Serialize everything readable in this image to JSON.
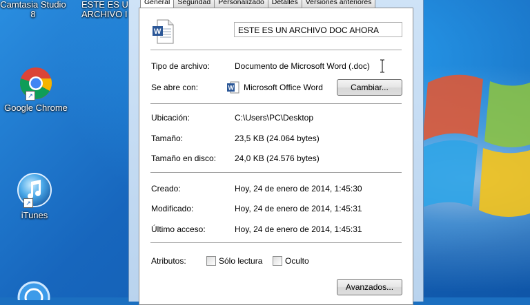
{
  "desktop": {
    "icons": [
      {
        "label": "Camtasia Studio 8",
        "name": "camtasia"
      },
      {
        "label": "ESTE ES UN ARCHIVO D...",
        "name": "doc"
      },
      {
        "label": "Google Chrome",
        "name": "chrome"
      },
      {
        "label": "iTunes",
        "name": "itunes"
      }
    ],
    "camtasia_line1": "Camtasia Studio",
    "camtasia_line2": "8",
    "doc_line1": "ESTE ES U",
    "doc_line2": "ARCHIVO I"
  },
  "dialog": {
    "tabs": [
      "General",
      "Seguridad",
      "Personalizado",
      "Detalles",
      "Versiones anteriores"
    ],
    "file_name": "ESTE ES UN ARCHIVO DOC AHORA",
    "file_type_label": "Tipo de archivo:",
    "file_type_value": "Documento de Microsoft Word (.doc)",
    "opens_with_label": "Se abre con:",
    "opens_with_value": "Microsoft Office Word",
    "change_button": "Cambiar...",
    "location_label": "Ubicación:",
    "location_value": "C:\\Users\\PC\\Desktop",
    "size_label": "Tamaño:",
    "size_value": "23,5 KB (24.064 bytes)",
    "disk_size_label": "Tamaño en disco:",
    "disk_size_value": "24,0 KB (24.576 bytes)",
    "created_label": "Creado:",
    "created_value": "Hoy, 24 de enero de 2014, 1:45:30",
    "modified_label": "Modificado:",
    "modified_value": "Hoy, 24 de enero de 2014, 1:45:31",
    "accessed_label": "Último acceso:",
    "accessed_value": "Hoy, 24 de enero de 2014, 1:45:31",
    "attributes_label": "Atributos:",
    "readonly_label": "Sólo lectura",
    "hidden_label": "Oculto",
    "advanced_button": "Avanzados..."
  },
  "colors": {
    "word_blue": "#2b5797",
    "desktop_blue": "#1766bd"
  }
}
